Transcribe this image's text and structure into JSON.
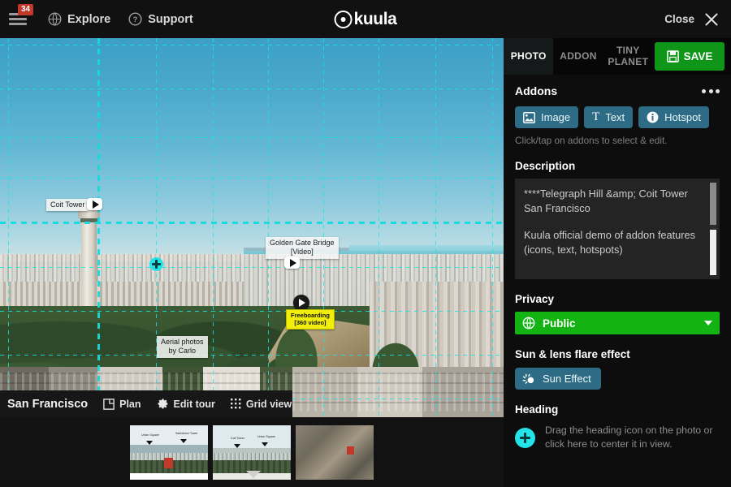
{
  "topbar": {
    "menu_badge": "34",
    "menu_icon": "hamburger-icon",
    "explore_label": "Explore",
    "explore_icon": "globe-icon",
    "support_label": "Support",
    "support_icon": "question-circle-icon",
    "brand": "kuula",
    "brand_icon": "kuula-circle-dot-icon",
    "close_label": "Close",
    "close_icon": "close-x-icon"
  },
  "viewer": {
    "title": "San Francisco",
    "tools": [
      {
        "label": "Plan",
        "icon": "floorplan-icon"
      },
      {
        "label": "Edit tour",
        "icon": "gear-icon"
      },
      {
        "label": "Grid view",
        "icon": "grid-dots-icon"
      }
    ],
    "hotspots": [
      {
        "label": "Coit Tower",
        "type": "text-label"
      },
      {
        "label": "Golden Gate Bridge\n[Video]",
        "line1": "Golden Gate Bridge",
        "line2": "[Video]",
        "type": "text-label"
      },
      {
        "label": "Aerial photos by Carlo",
        "line1": "Aerial photos",
        "line2": "by Carlo",
        "type": "text-label"
      },
      {
        "line1": "Freeboarding",
        "line2": "[360 video]",
        "type": "yellow-label"
      }
    ],
    "heading_marker_icon": "heading-crosshair-icon",
    "grid_color": "#16e6e6"
  },
  "thumbnails": {
    "items": [
      {
        "name": "thumbnail-1",
        "marks": [
          "Union Square",
          "Salesforce Tower"
        ]
      },
      {
        "name": "thumbnail-2",
        "marks": [
          "Coit Tower",
          "Union Square"
        ]
      },
      {
        "name": "thumbnail-3",
        "marks": []
      }
    ],
    "expand_icon": "chevron-down-icon"
  },
  "panel": {
    "tabs": [
      {
        "label": "PHOTO",
        "active": true
      },
      {
        "label": "ADDON",
        "active": false
      },
      {
        "label": "TINY PLANET",
        "line1": "TINY",
        "line2": "PLANET",
        "active": false
      }
    ],
    "save_label": "SAVE",
    "save_icon": "floppy-disk-icon",
    "save_color": "#0f9618",
    "addons": {
      "title": "Addons",
      "more_icon": "ellipsis-icon",
      "buttons": [
        {
          "label": "Image",
          "icon": "image-icon"
        },
        {
          "label": "Text",
          "icon": "text-t-icon"
        },
        {
          "label": "Hotspot",
          "icon": "info-circle-icon"
        }
      ],
      "hint": "Click/tap on addons to select & edit.",
      "button_color": "#2d6c84"
    },
    "description": {
      "label": "Description",
      "paragraph_1": "****Telegraph Hill &amp; Coit Tower San Francisco",
      "paragraph_2": "Kuula official demo of addon features (icons, text, hotspots)"
    },
    "privacy": {
      "label": "Privacy",
      "value": "Public",
      "icon": "globe-icon",
      "caret_icon": "caret-down-icon",
      "color": "#12b312"
    },
    "sun": {
      "label": "Sun & lens flare effect",
      "button_label": "Sun Effect",
      "button_icon": "sun-flare-icon"
    },
    "heading": {
      "label": "Heading",
      "icon": "heading-crosshair-icon",
      "hint": "Drag the heading icon on the photo or click here to center it in view."
    }
  }
}
